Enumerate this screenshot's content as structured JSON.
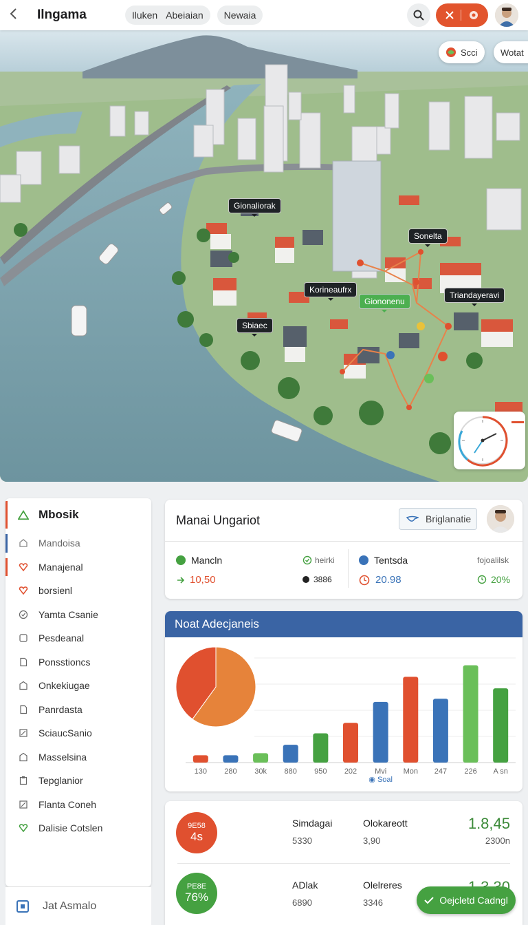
{
  "topbar": {
    "title": "Ilngama",
    "chips": [
      "Iluken",
      "Abeiaian",
      "Newaia"
    ],
    "icons": {
      "back": "chevron-left-icon",
      "search": "search-icon",
      "close": "close-icon",
      "badge": "settings-icon"
    },
    "accent": "#e2542d"
  },
  "map": {
    "chips": [
      "Scci",
      "Wotat"
    ],
    "labels": {
      "l1": "Gionaliorak",
      "l2": "Sonelta",
      "l3": "Korineaufrx",
      "l4": "Giononenu",
      "l5": "Triandayeravi",
      "l6": "Sbiaec"
    }
  },
  "sidebar": {
    "head": "Mbosik",
    "items": [
      "Mandoisa",
      "Manajenal",
      "borsienl",
      "Yamta Csanie",
      "Pesdeanal",
      "Ponsstioncs",
      "Onkekiugae",
      "Panrdasta",
      "SciaucSanio",
      "Masselsina",
      "Tepglanior",
      "Flanta Coneh",
      "Dalisie Cotslen"
    ],
    "footer": "Jat Asmalo"
  },
  "summary": {
    "title": "Manai Ungariot",
    "button": "Briglanatie",
    "left": {
      "name": "Mancln",
      "tag": "heirki",
      "value": "10,50",
      "delta": "3886"
    },
    "right": {
      "name": "Tentsda",
      "tag": "fojoalilsk",
      "value": "20.98",
      "delta": "20%"
    }
  },
  "chart_data": {
    "type": "bar",
    "title": "Noat Adecjaneis",
    "categories": [
      "130",
      "280",
      "30k",
      "880",
      "950",
      "202",
      "Mvi",
      "Mon",
      "247",
      "226",
      "A sn"
    ],
    "values": [
      7,
      7,
      9,
      17,
      28,
      38,
      58,
      82,
      61,
      93,
      71
    ],
    "bar_colors": [
      "#e0502f",
      "#3a73b8",
      "#6abf59",
      "#3a73b8",
      "#45a141",
      "#e0502f",
      "#3a73b8",
      "#e0502f",
      "#3a73b8",
      "#6abf59",
      "#45a141"
    ],
    "ylim": [
      0,
      100
    ],
    "grid": true,
    "legend_label": "Soal",
    "pie": {
      "slices": [
        60,
        40
      ],
      "colors": [
        "#e6833a",
        "#e0502f"
      ]
    }
  },
  "bottom": {
    "row1": {
      "badge_a": "9E58",
      "badge_b": "4s",
      "col1": "Simdagai",
      "col1_sub": "5330",
      "col2": "Olokareott",
      "col2_sub": "3,90",
      "num": "1.8,45",
      "num_sub": "2300n"
    },
    "row2": {
      "badge_a": "PE8E",
      "badge_b": "76%",
      "col1": "ADlak",
      "col1_sub": "6890",
      "col2": "Olelreres",
      "col2_sub": "3346",
      "num": "1.3.30"
    },
    "confirm": "Oejcletd Cadngl"
  }
}
